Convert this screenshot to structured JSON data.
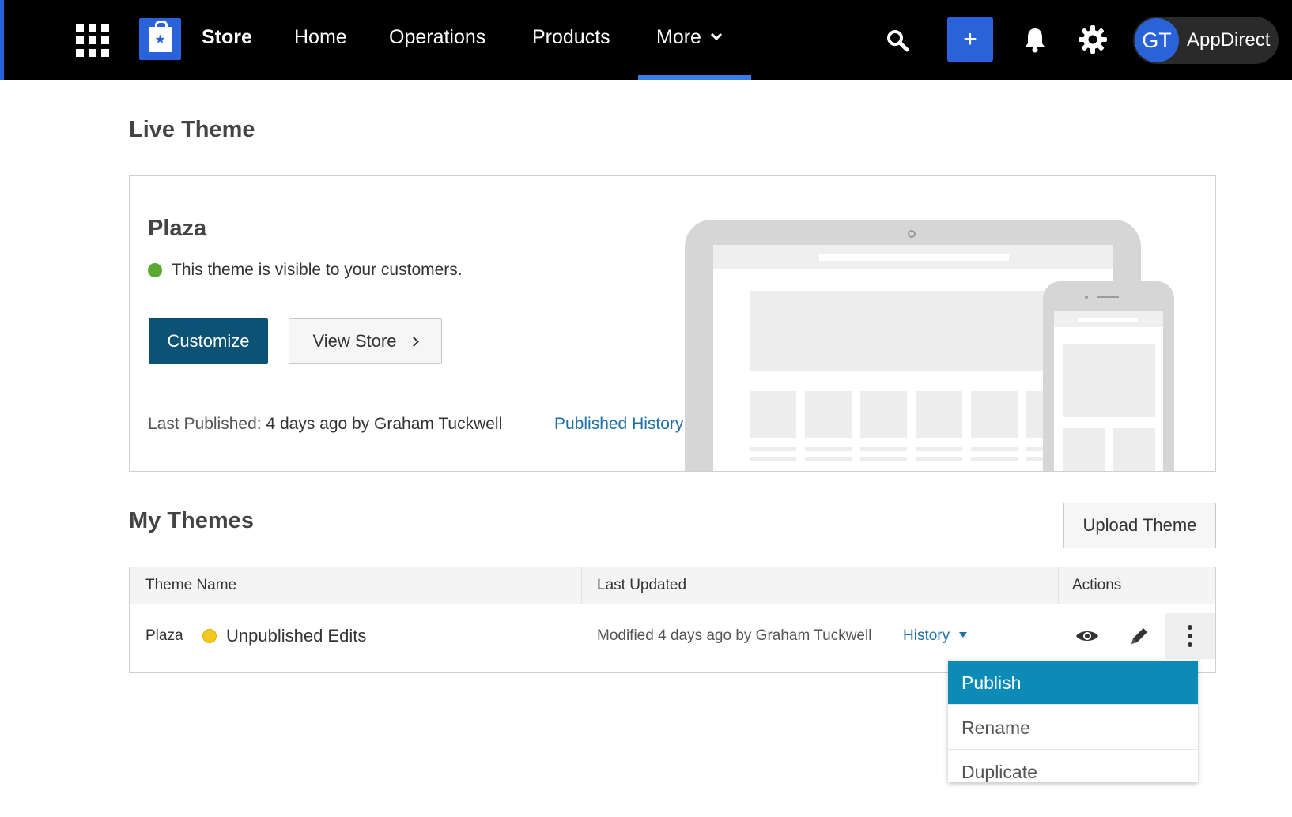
{
  "nav": {
    "brand": "Store",
    "items": [
      "Home",
      "Operations",
      "Products",
      "More"
    ],
    "active_item": "More",
    "plus_label": "+",
    "user": {
      "initials": "GT",
      "name": "AppDirect"
    }
  },
  "live_theme": {
    "heading": "Live Theme",
    "name": "Plaza",
    "status_text": "This theme is visible to your customers.",
    "status_color": "#5aa832",
    "customize_label": "Customize",
    "view_store_label": "View Store",
    "last_published_label": "Last Published:",
    "last_published_value": "4 days ago by Graham Tuckwell",
    "published_history_label": "Published History"
  },
  "my_themes": {
    "heading": "My Themes",
    "upload_label": "Upload Theme",
    "columns": [
      "Theme Name",
      "Last Updated",
      "Actions"
    ],
    "rows": [
      {
        "name": "Plaza",
        "status": "Unpublished Edits",
        "status_color": "#f2c81e",
        "modified": "Modified 4 days ago by Graham Tuckwell",
        "history_label": "History"
      }
    ],
    "actions_menu": [
      "Publish",
      "Rename",
      "Duplicate"
    ],
    "actions_menu_highlighted": "Publish"
  },
  "colors": {
    "nav_bg": "#000000",
    "accent_blue": "#2a62d9",
    "primary_button": "#0b5275",
    "link": "#1f6fa8",
    "menu_highlight": "#0b8bb5"
  },
  "icons": [
    "apps-grid-icon",
    "store-bag-icon",
    "search-icon",
    "bell-icon",
    "gear-icon",
    "eye-icon",
    "pencil-icon",
    "kebab-menu-icon"
  ]
}
